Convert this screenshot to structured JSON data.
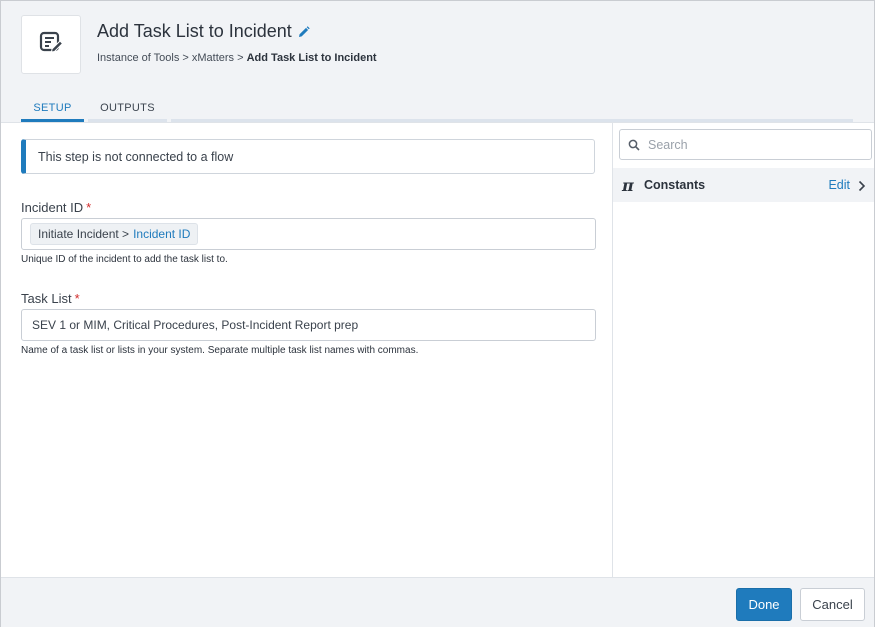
{
  "header": {
    "title": "Add Task List to Incident",
    "breadcrumb": {
      "path": "Instance of Tools > xMatters > ",
      "current": "Add Task List to Incident"
    }
  },
  "tabs": [
    {
      "label": "SETUP",
      "active": true
    },
    {
      "label": "OUTPUTS",
      "active": false
    }
  ],
  "notice": "This step is not connected to a flow",
  "fields": {
    "incident_id": {
      "label": "Incident ID",
      "required_mark": "*",
      "token_prefix": "Initiate Incident >",
      "token_value": "Incident ID",
      "help": "Unique ID of the incident to add the task list to."
    },
    "task_list": {
      "label": "Task List",
      "required_mark": "*",
      "value": "SEV 1 or MIM, Critical Procedures, Post-Incident Report prep",
      "help": "Name of a task list or lists in your system. Separate multiple task list names with commas."
    }
  },
  "sidebar": {
    "search_placeholder": "Search",
    "constants_icon": "π",
    "constants_label": "Constants",
    "edit_label": "Edit"
  },
  "footer": {
    "done_label": "Done",
    "cancel_label": "Cancel"
  },
  "colors": {
    "accent": "#1f7bbd",
    "required": "#d12b2b",
    "header_bg": "#f1f3f6"
  }
}
